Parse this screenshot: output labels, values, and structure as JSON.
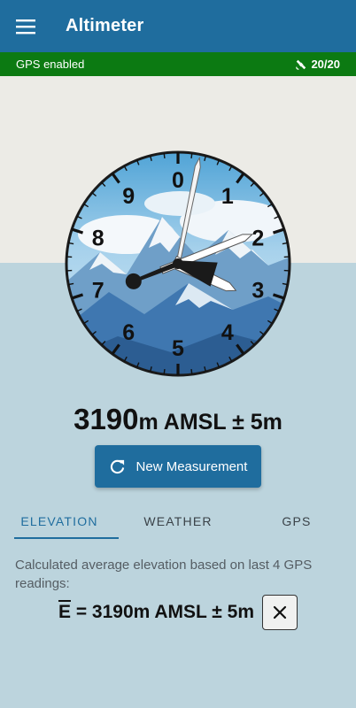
{
  "app": {
    "title": "Altimeter"
  },
  "gps": {
    "status": "GPS enabled",
    "satellites": "20/20"
  },
  "dial": {
    "numerals": [
      "0",
      "1",
      "2",
      "3",
      "4",
      "5",
      "6",
      "7",
      "8",
      "9"
    ],
    "altitude_m": 3190
  },
  "reading": {
    "value": "3190",
    "unit": "m AMSL ± 5m"
  },
  "buttons": {
    "new_measurement": "New Measurement"
  },
  "tabs": [
    {
      "label": "ELEVATION",
      "active": true
    },
    {
      "label": "WEATHER",
      "active": false
    },
    {
      "label": "GPS",
      "active": false
    }
  ],
  "elevation": {
    "description": "Calculated average elevation based on last 4 GPS readings:",
    "average_symbol": "E",
    "average_value": " = 3190m AMSL ± 5m"
  },
  "colors": {
    "primary": "#1f6d9e",
    "gps_bar": "#0c7a12",
    "background": "#bcd4dd"
  }
}
